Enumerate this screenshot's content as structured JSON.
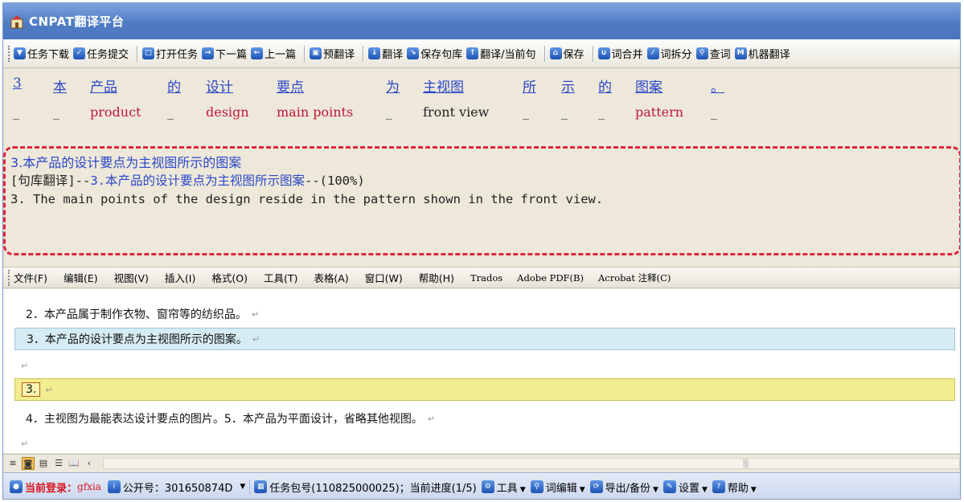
{
  "window": {
    "title": "CNPAT翻译平台"
  },
  "toolbar": {
    "buttons": [
      "任务下载",
      "任务提交",
      "打开任务",
      "下一篇",
      "上一篇",
      "预翻译",
      "翻译",
      "保存句库",
      "翻译/当前句",
      "保存",
      "词合并",
      "词拆分",
      "查词",
      "机器翻译"
    ]
  },
  "tokens": {
    "source": [
      "3",
      "本",
      "产品",
      "的",
      "设计",
      "要点",
      "为",
      "主视图",
      "所",
      "示",
      "的",
      "图案",
      "。"
    ],
    "target": [
      "_",
      "_",
      "product",
      "_",
      "design",
      "main points",
      "_",
      "front view",
      "_",
      "_",
      "_",
      "pattern",
      "_"
    ]
  },
  "memory": {
    "source": "3.本产品的设计要点为主视图所示的图案",
    "tm_tag": "[句库翻译]--",
    "tm_source": "3.本产品的设计要点为主视图所示图案",
    "tm_score": "--(100%)",
    "target": "3. The main points of the design reside in the pattern shown in the front view."
  },
  "menubar": {
    "items": [
      "文件(F)",
      "编辑(E)",
      "视图(V)",
      "插入(I)",
      "格式(O)",
      "工具(T)",
      "表格(A)",
      "窗口(W)",
      "帮助(H)"
    ],
    "latin_items": [
      "Trados",
      "Adobe PDF(B)",
      "Acrobat 注释(C)"
    ]
  },
  "document": {
    "line1": "2．本产品属于制作衣物、窗帘等的纺织品。",
    "line2": "3．本产品的设计要点为主视图所示的图案。",
    "line4": "3.",
    "line5": "4．主视图为最能表达设计要点的图片。5．本产品为平面设计，省略其他视图。",
    "para_mark": "↵"
  },
  "statusbar": {
    "login_label": "当前登录：",
    "user": "gfxia",
    "publication_no": "公开号：301650874D",
    "package": "任务包号(110825000025)；当前进度(1/5)",
    "tools": "工具",
    "word_edit": "词编辑",
    "export": "导出/备份",
    "settings": "设置",
    "help": "帮助"
  },
  "colors": {
    "accent_blue": "#2b47c8",
    "target_red": "#c0183a",
    "highlight_dash": "#e0263a",
    "active_line_blue": "#d6ecf5",
    "active_line_yellow": "#f2ed8e"
  }
}
